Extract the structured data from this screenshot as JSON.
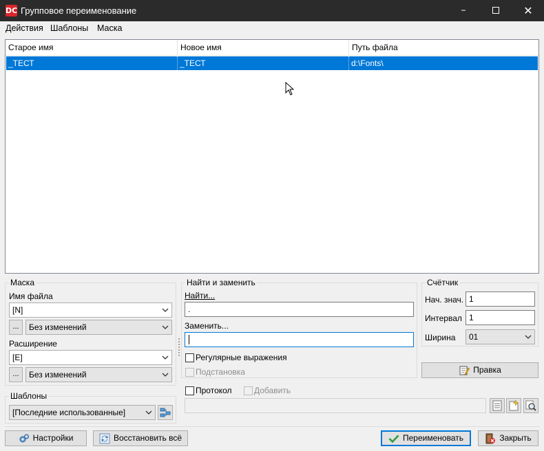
{
  "window": {
    "title": "Групповое переименование",
    "app_icon": "total-commander-icon"
  },
  "menu": [
    "Действия",
    "Шаблоны",
    "Маска"
  ],
  "list": {
    "columns": [
      "Старое имя",
      "Новое имя",
      "Путь файла"
    ],
    "rows": [
      {
        "old": "_ТЕСТ",
        "new": "_ТЕСТ",
        "path": "d:\\Fonts\\"
      }
    ],
    "selection_color": "#0078d7"
  },
  "mask": {
    "title": "Маска",
    "filename_label": "Имя файла",
    "filename_value": "[N]",
    "filename_case": "Без изменений",
    "ext_label": "Расширение",
    "ext_value": "[E]",
    "ext_case": "Без изменений",
    "ellipsis": "..."
  },
  "templates": {
    "title": "Шаблоны",
    "value": "[Последние использованные]"
  },
  "find_replace": {
    "title": "Найти и заменить",
    "find_label": "Найти...",
    "find_value": ".",
    "replace_label": "Заменить...",
    "replace_value": "",
    "regex_label": "Регулярные выражения",
    "subst_label": "Подстановка"
  },
  "counter": {
    "title": "Счётчик",
    "start_label": "Нач. знач.",
    "start_value": "1",
    "interval_label": "Интервал",
    "interval_value": "1",
    "width_label": "Ширина",
    "width_value": "01"
  },
  "edit_button": "Правка",
  "log": {
    "protocol_label": "Протокол",
    "append_label": "Добавить",
    "path_value": ""
  },
  "buttons": {
    "settings": "Настройки",
    "restore_all": "Восстановить всё",
    "rename": "Переименовать",
    "close": "Закрыть"
  }
}
